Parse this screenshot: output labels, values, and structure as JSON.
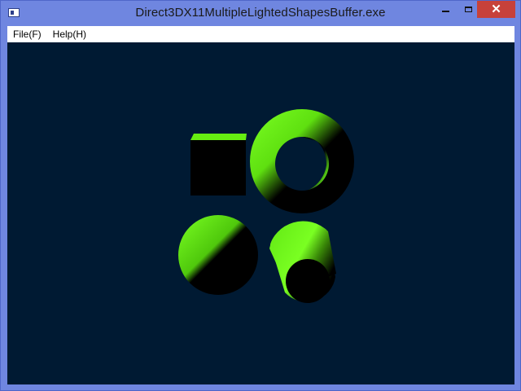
{
  "window": {
    "title": "Direct3DX11MultipleLightedShapesBuffer.exe",
    "icon": "app-window-icon"
  },
  "caption_buttons": {
    "minimize_icon": "minimize-icon",
    "maximize_icon": "maximize-icon",
    "close_icon": "close-icon",
    "close_glyph": "✕"
  },
  "menu": {
    "items": [
      {
        "label": "File(F)"
      },
      {
        "label": "Help(H)"
      }
    ]
  },
  "scene": {
    "background_color": "#001a33",
    "light_color": "#66ff11",
    "shapes": [
      "cube",
      "torus",
      "sphere",
      "cylinder"
    ]
  }
}
